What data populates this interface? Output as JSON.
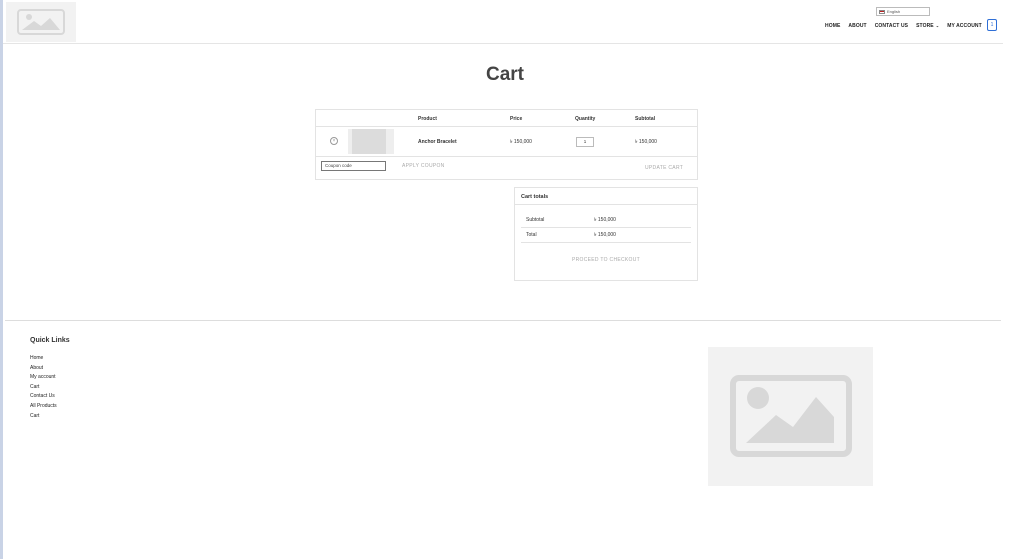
{
  "header": {
    "language": "English",
    "nav": [
      {
        "label": "HOME"
      },
      {
        "label": "ABOUT"
      },
      {
        "label": "CONTACT US"
      },
      {
        "label": "STORE",
        "has_dropdown": true
      },
      {
        "label": "MY ACCOUNT"
      }
    ],
    "cart_count": "1",
    "accent_color": "#2f6fd6"
  },
  "page": {
    "title": "Cart"
  },
  "cart": {
    "columns": [
      "Product",
      "Price",
      "Quantity",
      "Subtotal"
    ],
    "items": [
      {
        "name": "Anchor Bracelet",
        "price": "৳ 150,000",
        "quantity": "1",
        "subtotal": "৳ 150,000"
      }
    ],
    "coupon_placeholder": "Coupon code",
    "apply_coupon_label": "APPLY COUPON",
    "update_cart_label": "UPDATE CART"
  },
  "totals": {
    "title": "Cart totals",
    "subtotal_label": "Subtotal",
    "subtotal_value": "৳ 150,000",
    "total_label": "Total",
    "total_value": "৳ 150,000",
    "checkout_label": "PROCEED TO CHECKOUT"
  },
  "footer": {
    "quick_links_title": "Quick Links",
    "links": [
      "Home",
      "About",
      "My account",
      "Cart",
      "Contact Us",
      "All Products",
      "Cart"
    ]
  }
}
